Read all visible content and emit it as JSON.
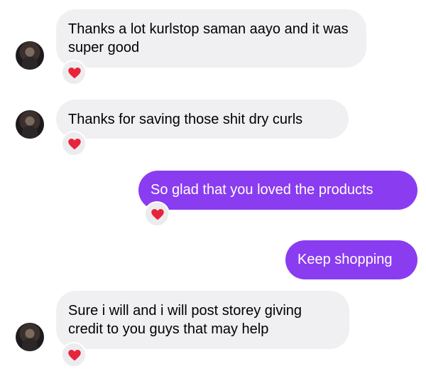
{
  "conversation": {
    "messages": [
      {
        "direction": "incoming",
        "text": "Thanks a lot kurlstop saman aayo and it was super good",
        "reaction": "heart"
      },
      {
        "direction": "incoming",
        "text": "Thanks for saving those shit dry curls",
        "reaction": "heart"
      },
      {
        "direction": "outgoing",
        "text": "So glad that you loved the products",
        "reaction": "heart"
      },
      {
        "direction": "outgoing",
        "text": "Keep shopping"
      },
      {
        "direction": "incoming",
        "text": "Sure i will and i will post storey giving credit to you guys that may help",
        "reaction": "heart"
      }
    ]
  },
  "colors": {
    "outgoing_bubble": "#8a3cf0",
    "incoming_bubble": "#f0f0f2",
    "reaction_heart": "#e8243a"
  }
}
